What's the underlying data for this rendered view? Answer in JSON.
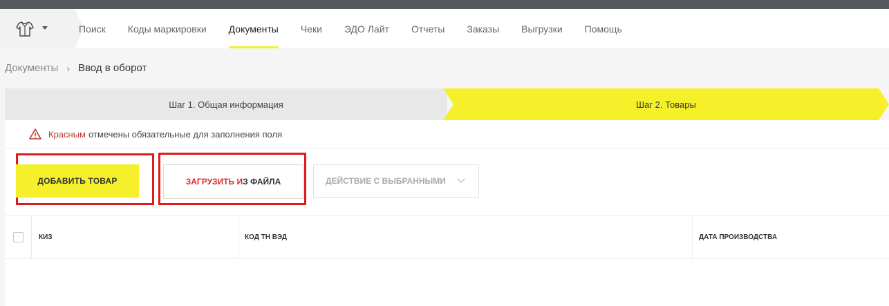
{
  "nav": {
    "logo_icon": "shirt-icon",
    "items": [
      {
        "label": "Поиск",
        "active": false
      },
      {
        "label": "Коды маркировки",
        "active": false
      },
      {
        "label": "Документы",
        "active": true
      },
      {
        "label": "Чеки",
        "active": false
      },
      {
        "label": "ЭДО Лайт",
        "active": false
      },
      {
        "label": "Отчеты",
        "active": false
      },
      {
        "label": "Заказы",
        "active": false
      },
      {
        "label": "Выгрузки",
        "active": false
      },
      {
        "label": "Помощь",
        "active": false
      }
    ]
  },
  "breadcrumb": {
    "parent": "Документы",
    "separator": "›",
    "current": "Ввод в оборот"
  },
  "steps": {
    "step1": "Шаг 1. Общая информация",
    "step2": "Шаг 2. Товары"
  },
  "notice": {
    "red_word": "Красным",
    "rest": "отмечены обязательные для заполнения поля"
  },
  "buttons": {
    "add_item": "ДОБАВИТЬ ТОВАР",
    "upload_red": "ЗАГРУЗИТЬ И",
    "upload_rest": "З ФАЙЛА",
    "action_selected": "ДЕЙСТВИЕ С ВЫБРАННЫМИ"
  },
  "table": {
    "columns": [
      "КИЗ",
      "КОД ТН ВЭД",
      "ДАТА ПРОИЗВОДСТВА"
    ]
  },
  "colors": {
    "accent_yellow": "#f5f02a",
    "highlight_red": "#e11919",
    "topbar": "#55595e"
  }
}
